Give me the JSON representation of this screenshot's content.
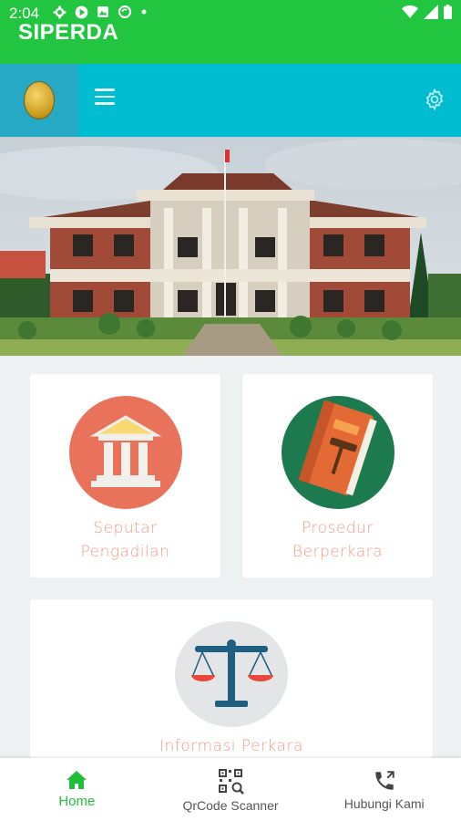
{
  "status_bar": {
    "time": "2:04",
    "left_icons": [
      "gear-icon",
      "play-icon",
      "photo-icon",
      "sync-icon",
      "dot-icon"
    ],
    "right_icons": [
      "wifi-icon",
      "signal-icon",
      "battery-icon"
    ]
  },
  "app": {
    "title": "SIPERDA"
  },
  "toolbar": {
    "logo_icon": "court-emblem-icon",
    "menu_icon": "hamburger-menu-icon",
    "settings_icon": "gear-icon"
  },
  "banner": {
    "image": "court-building-photo"
  },
  "menu_cards": [
    {
      "label_line1": "Seputar",
      "label_line2": "Pengadilan",
      "icon": "courthouse-icon",
      "color": "#e8735a"
    },
    {
      "label_line1": "Prosedur",
      "label_line2": "Berperkara",
      "icon": "law-book-gavel-icon",
      "color": "#1d7a4e"
    },
    {
      "label_line1": "Informasi Perkara",
      "label_line2": "",
      "icon": "scales-of-justice-icon",
      "color": "#e3e5e6"
    }
  ],
  "bottom_nav": [
    {
      "label": "Home",
      "icon": "home-icon",
      "active": true
    },
    {
      "label": "QrCode Scanner",
      "icon": "qr-code-icon",
      "active": false
    },
    {
      "label": "Hubungi Kami",
      "icon": "phone-icon",
      "active": false
    }
  ],
  "colors": {
    "status_green": "#22c53f",
    "toolbar_teal": "#00bcd0",
    "card_label": "#f29a86",
    "active_nav": "#1fbf3a"
  }
}
